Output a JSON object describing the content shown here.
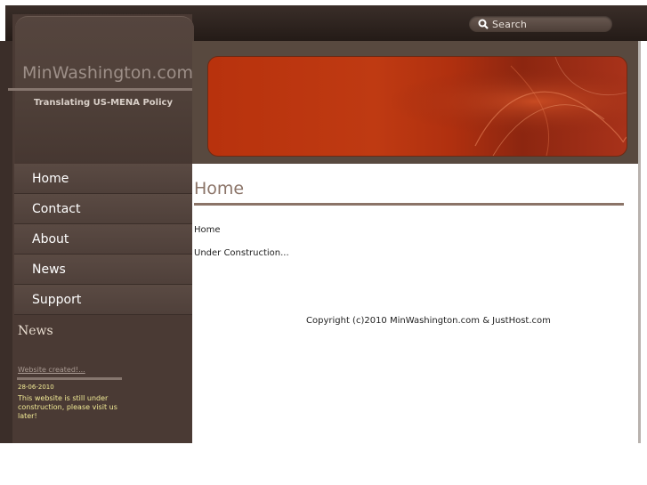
{
  "header": {
    "search": {
      "placeholder": "Search",
      "icon": "search-icon"
    }
  },
  "site": {
    "title": "MinWashington.com",
    "tagline": "Translating US-MENA Policy"
  },
  "nav": {
    "items": [
      {
        "label": "Home"
      },
      {
        "label": "Contact"
      },
      {
        "label": "About"
      },
      {
        "label": "News"
      },
      {
        "label": "Support"
      }
    ]
  },
  "news": {
    "heading": "News",
    "link": "Website created!...",
    "date": "28-06-2010",
    "body": "This website is still under construction, please visit us later!"
  },
  "main": {
    "heading": "Home",
    "breadcrumb": "Home",
    "body": "Under Construction...",
    "copyright": "Copyright (c)2010 MinWashington.com & JustHost.com"
  },
  "colors": {
    "sidebar": "#4a3a34",
    "banner": "#b8320d",
    "heading": "#8b7468",
    "news_text": "#f2eb96"
  }
}
